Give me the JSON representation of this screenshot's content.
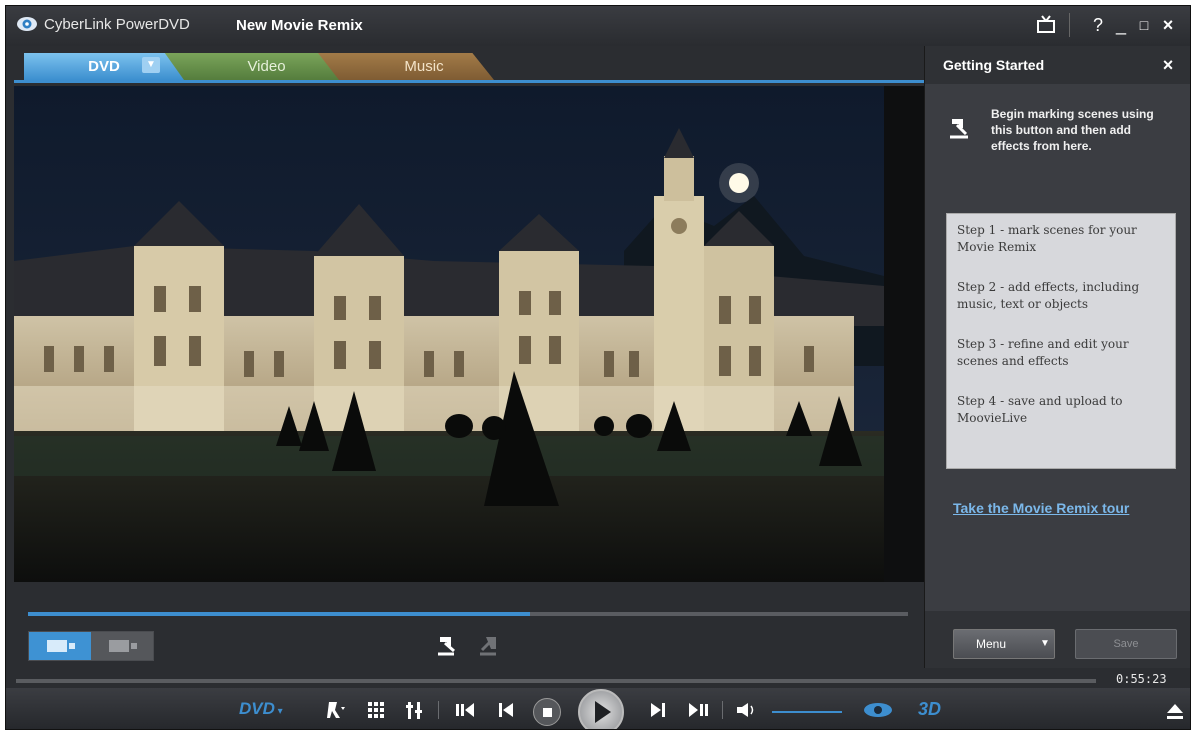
{
  "window": {
    "app_name": "CyberLink PowerDVD",
    "document_title": "New Movie Remix",
    "controls": {
      "help": "?",
      "minimize": "_",
      "maximize": "□",
      "close": "×"
    }
  },
  "tabs": [
    {
      "label": "DVD",
      "color": "#3c8fcf",
      "active": true
    },
    {
      "label": "Video",
      "color": "#557d3d",
      "active": false
    },
    {
      "label": "Music",
      "color": "#7f5c33",
      "active": false
    }
  ],
  "timeline": {
    "progress_fraction": 0.57
  },
  "panel": {
    "title": "Getting Started",
    "close_label": "×",
    "intro": "Begin marking scenes using this button and then add effects from here.",
    "steps": [
      "Step 1 - mark scenes for your Movie Remix",
      "Step 2 - add effects, including music, text or objects",
      "Step 3 - refine and edit your scenes and effects",
      "Step 4 - save and upload to MoovieLive"
    ],
    "tour_link": "Take the Movie Remix tour",
    "menu_button": "Menu",
    "save_button": "Save"
  },
  "player": {
    "time": "0:55:23",
    "source": "DVD",
    "mode_3d": "3D",
    "accent": "#3d8ecf",
    "icons": [
      "bookmark-icon",
      "chapters-grid-icon",
      "settings-sliders-icon",
      "step-back-icon",
      "previous-icon",
      "stop-icon",
      "play-icon",
      "next-icon",
      "step-forward-icon",
      "volume-icon",
      "trueview-eye-icon",
      "eject-icon"
    ]
  }
}
